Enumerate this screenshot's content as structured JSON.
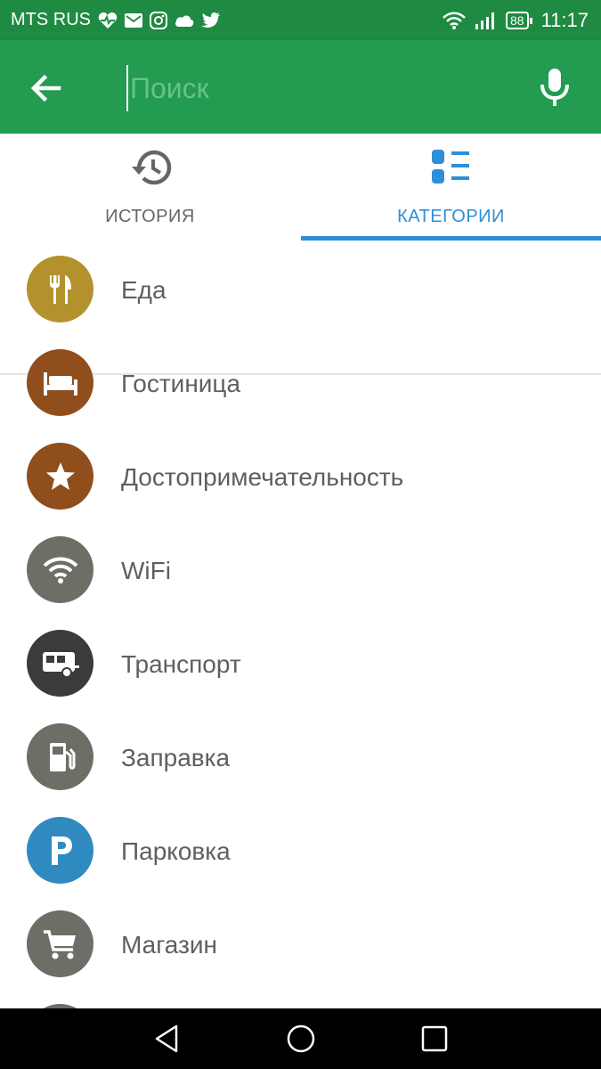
{
  "status_bar": {
    "carrier": "MTS RUS",
    "battery": "88",
    "time": "11:17",
    "icons": [
      "heart-rate-icon",
      "mail-icon",
      "instagram-icon",
      "cloud-icon",
      "twitter-icon",
      "wifi-icon",
      "signal-icon",
      "battery-icon"
    ]
  },
  "toolbar": {
    "search_placeholder": "Поиск",
    "search_value": "",
    "back_icon": "arrow-left-icon",
    "mic_icon": "microphone-icon",
    "color": "#239b51"
  },
  "tabs": [
    {
      "label": "ИСТОРИЯ",
      "icon": "history-icon",
      "active": false
    },
    {
      "label": "КАТЕГОРИИ",
      "icon": "categories-icon",
      "active": true
    }
  ],
  "accent_color": "#2d8fd6",
  "categories": [
    {
      "label": "Еда",
      "icon": "fork-knife-icon",
      "color": "#b3922e"
    },
    {
      "label": "Гостиница",
      "icon": "bed-icon",
      "color": "#8f4e1c"
    },
    {
      "label": "Достопримечательность",
      "icon": "star-icon",
      "color": "#8f4e1c"
    },
    {
      "label": "WiFi",
      "icon": "wifi-icon",
      "color": "#6e6e66"
    },
    {
      "label": "Транспорт",
      "icon": "bus-icon",
      "color": "#3b3b3b"
    },
    {
      "label": "Заправка",
      "icon": "gas-pump-icon",
      "color": "#6e6e66"
    },
    {
      "label": "Парковка",
      "icon": "parking-icon",
      "color": "#2f8ac0"
    },
    {
      "label": "Магазин",
      "icon": "shopping-cart-icon",
      "color": "#6e6e66"
    }
  ],
  "nav_bar": {
    "buttons": [
      "back-triangle-icon",
      "home-circle-icon",
      "recents-square-icon"
    ]
  }
}
